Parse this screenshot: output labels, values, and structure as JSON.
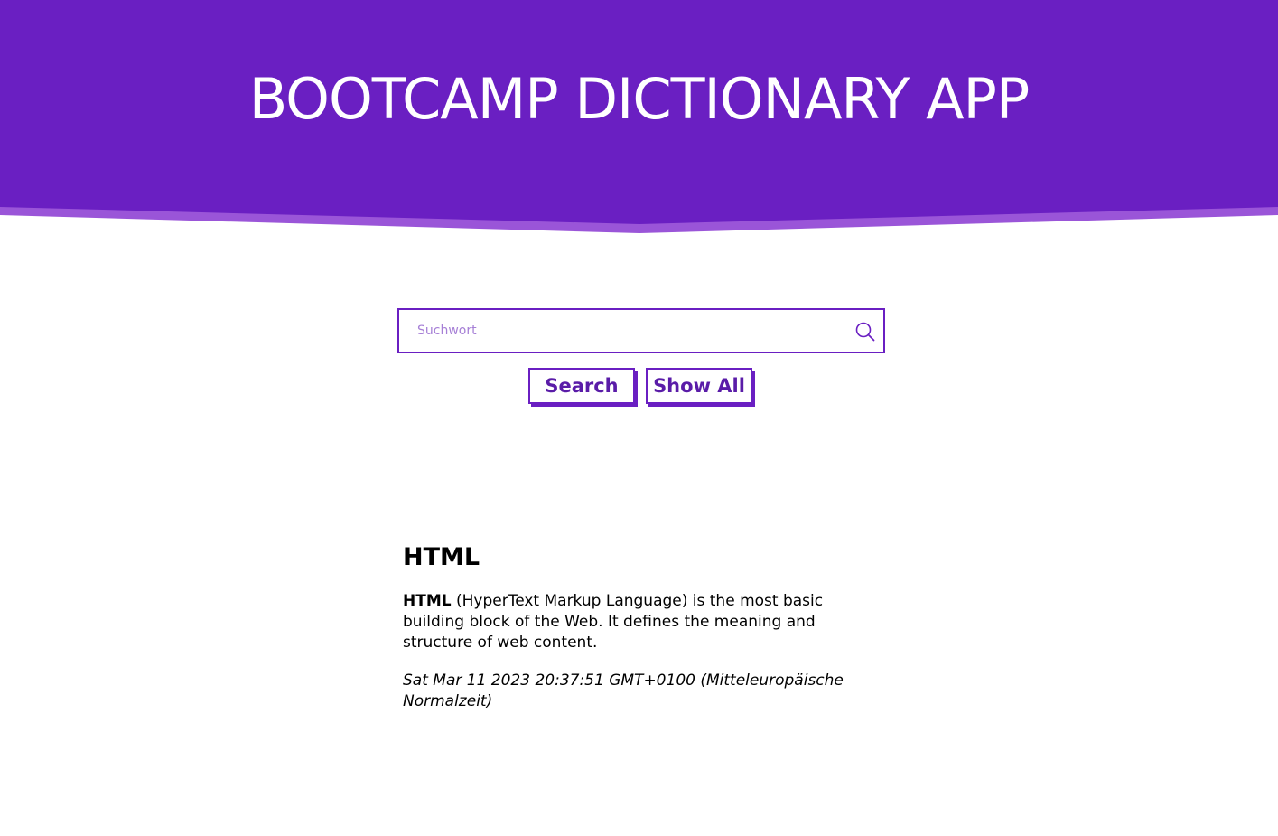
{
  "header": {
    "title": "BOOTCAMP DICTIONARY APP",
    "background_color": "#6a1fc2",
    "accent_stripe_color": "#9a55d8"
  },
  "search": {
    "placeholder": "Suchwort",
    "value": "",
    "icon": "search-icon"
  },
  "buttons": {
    "search_label": "Search",
    "show_all_label": "Show All",
    "accent_color": "#6a1fc2"
  },
  "entries": [
    {
      "term": "HTML",
      "definition_term": "HTML",
      "definition_rest": " (HyperText Markup Language) is the most basic building block of the Web. It defines the meaning and structure of web content.",
      "date": "Sat Mar 11 2023 20:37:51 GMT+0100 (Mitteleuropäische Normalzeit)"
    }
  ]
}
